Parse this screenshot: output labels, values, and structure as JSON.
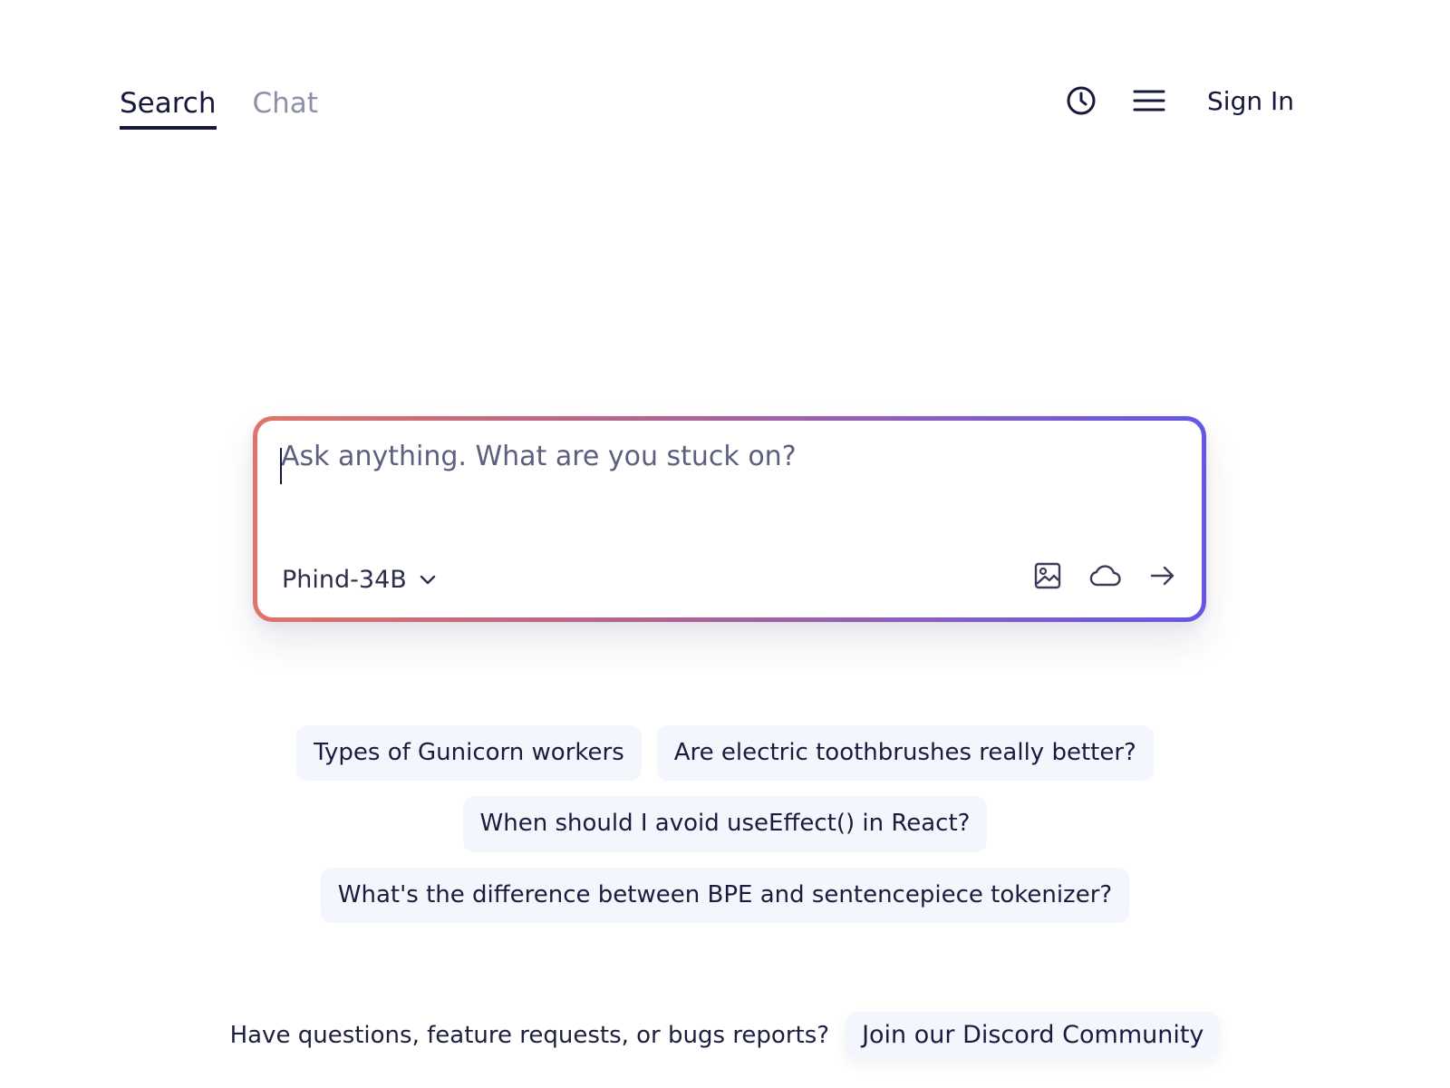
{
  "header": {
    "tabs": [
      {
        "label": "Search",
        "active": true
      },
      {
        "label": "Chat",
        "active": false
      }
    ],
    "icons": [
      "history-icon",
      "menu-icon"
    ],
    "sign_in_label": "Sign In"
  },
  "search": {
    "placeholder": "Ask anything. What are you stuck on?",
    "value": "",
    "model_label": "Phind-34B",
    "actions": [
      "image-icon",
      "cloud-icon",
      "arrow-right-icon"
    ],
    "border_gradient": [
      "#e07468",
      "#ad6494",
      "#8b5fc0",
      "#6457e6"
    ]
  },
  "suggestions": [
    "Types of Gunicorn workers",
    "Are electric toothbrushes really better?",
    "When should I avoid useEffect() in React?",
    "What's the difference between BPE and sentencepiece tokenizer?"
  ],
  "footer": {
    "text": "Have questions, feature requests, or bugs reports?",
    "discord_label": "Join our Discord Community"
  },
  "colors": {
    "text": "#15173b",
    "muted": "#8d90a8",
    "chip_bg": "#f3f6fd"
  }
}
